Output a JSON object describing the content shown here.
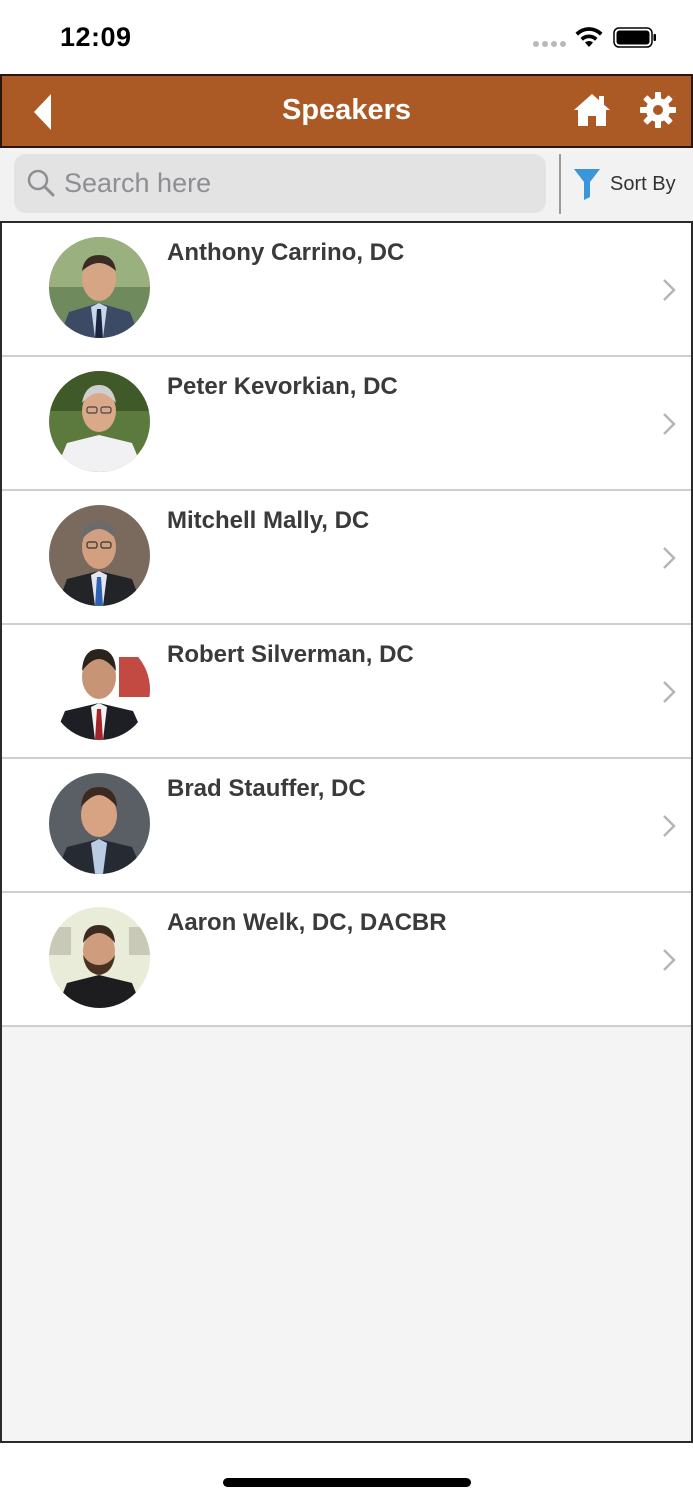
{
  "status_bar": {
    "time": "12:09"
  },
  "header": {
    "title": "Speakers"
  },
  "search": {
    "placeholder": "Search here",
    "value": ""
  },
  "sort": {
    "label": "Sort By"
  },
  "speakers": [
    {
      "name": "Anthony Carrino, DC"
    },
    {
      "name": "Peter Kevorkian, DC"
    },
    {
      "name": "Mitchell Mally, DC"
    },
    {
      "name": "Robert Silverman, DC"
    },
    {
      "name": "Brad Stauffer, DC"
    },
    {
      "name": "Aaron Welk, DC, DACBR"
    }
  ],
  "colors": {
    "header_bg": "#ab5a25",
    "header_border": "#2a1608",
    "filter_icon": "#3b95d9",
    "list_bg": "#f4f4f4"
  }
}
